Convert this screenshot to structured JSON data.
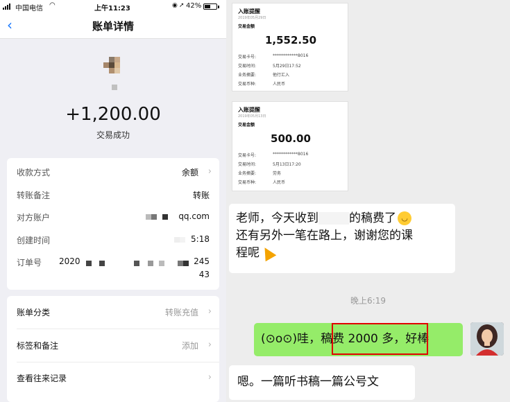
{
  "status_bar": {
    "carrier": "中国电信",
    "time": "上午11:23",
    "battery": "42%"
  },
  "nav": {
    "title": "账单详情"
  },
  "transaction": {
    "amount": "+1,200.00",
    "status": "交易成功"
  },
  "details": {
    "payment_method_label": "收款方式",
    "payment_method_value": "余额",
    "remark_label": "转账备注",
    "remark_value": "转账",
    "account_label": "对方账户",
    "account_value": "qq.com",
    "created_label": "创建时间",
    "created_value": "5:18",
    "order_label": "订单号",
    "order_prefix": "2020",
    "order_suffix": "245",
    "order_suffix_line2": "43"
  },
  "actions": {
    "category_label": "账单分类",
    "category_value": "转账充值",
    "tags_label": "标签和备注",
    "tags_value": "添加",
    "history_label": "查看往来记录"
  },
  "receipts": [
    {
      "title": "入账提醒",
      "date": "2019年05月29日",
      "amount_label": "交易金额",
      "amount": "1,552.50",
      "fields": [
        {
          "k": "交易卡号:",
          "v": "************8016"
        },
        {
          "k": "交易时间:",
          "v": "5月29日17:52"
        },
        {
          "k": "业务摘要:",
          "v": "他行汇入"
        },
        {
          "k": "交易币种:",
          "v": "人民币"
        }
      ]
    },
    {
      "title": "入账提醒",
      "date": "2019年05月13日",
      "amount_label": "交易金额",
      "amount": "500.00",
      "fields": [
        {
          "k": "交易卡号:",
          "v": "************8016"
        },
        {
          "k": "交易时间:",
          "v": "5月13日17:20"
        },
        {
          "k": "业务摘要:",
          "v": "劳务"
        },
        {
          "k": "交易币种:",
          "v": "人民币"
        }
      ]
    }
  ],
  "chat": {
    "msg1_line1_a": "老师，今天收到",
    "msg1_line1_b": "的稿费了",
    "msg1_line2": "还有另外一笔在路上，谢谢您的课",
    "msg1_line3": "程呢",
    "timestamp": "晚上6:19",
    "msg2_a": "(⊙o⊙)哇，",
    "msg2_highlight": "稿费 2000 多，",
    "msg2_b": "好棒",
    "msg3": "嗯。一篇听书稿一篇公号文"
  },
  "colors": {
    "accent_blue": "#1677ff",
    "wechat_green": "#95ec69",
    "highlight_red": "#e00000"
  }
}
